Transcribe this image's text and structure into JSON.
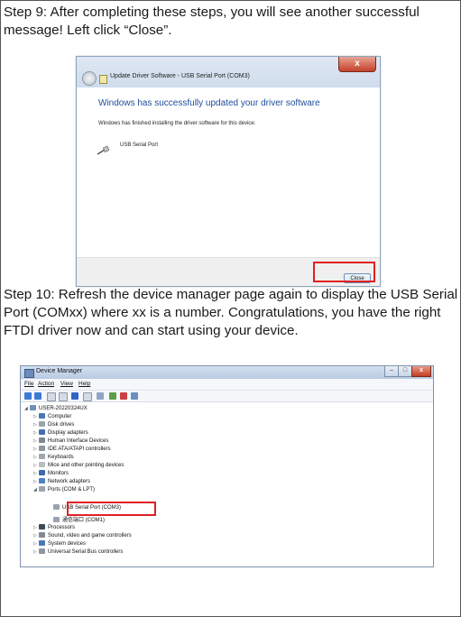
{
  "step9": {
    "text": "Step 9: After completing these steps, you will see another successful message! Left click “Close”."
  },
  "dialog": {
    "title": "Update Driver Software - USB Serial Port (COM3)",
    "close_x": "x",
    "heading": "Windows has successfully updated your driver software",
    "message": "Windows has finished installing the driver software for this device:",
    "device_name": "USB Serial Port",
    "close_button": "Close"
  },
  "step10": {
    "text": "Step 10: Refresh the device manager page again to display the USB Serial Port (COMxx) where xx is a number. Congratulations, you have the right FTDI driver now and can start using your device."
  },
  "device_manager": {
    "title": "Device Manager",
    "menu": [
      "File",
      "Action",
      "View",
      "Help"
    ],
    "computer_name": "USER-20220324UX",
    "tree": [
      "Computer",
      "Disk drives",
      "Display adapters",
      "Human Interface Devices",
      "IDE ATA/ATAPI controllers",
      "Keyboards",
      "Mice and other pointing devices",
      "Monitors",
      "Network adapters",
      "Ports (COM & LPT)",
      "USB Serial Port (COM3)",
      "通信端口 (COM1)",
      "Processors",
      "Sound, video and game controllers",
      "System devices",
      "Universal Serial Bus controllers"
    ]
  },
  "colors": {
    "highlight": "#e02020",
    "dialog_heading": "#1f4d9b"
  }
}
